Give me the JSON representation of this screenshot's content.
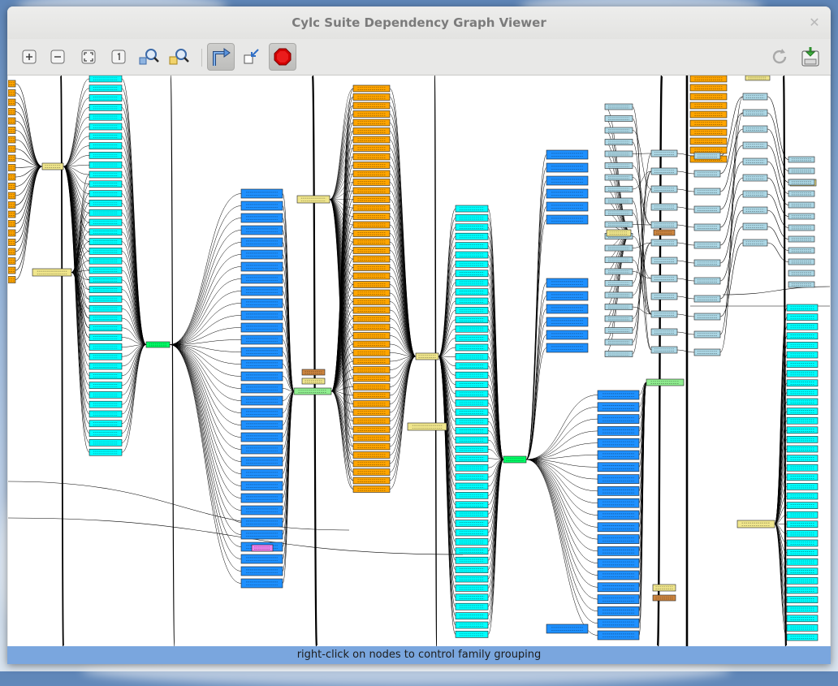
{
  "window": {
    "title": "Cylc Suite Dependency Graph Viewer"
  },
  "toolbar": {
    "buttons": [
      {
        "name": "zoom-in-button",
        "icon": "zoom-in-icon"
      },
      {
        "name": "zoom-out-button",
        "icon": "zoom-out-icon"
      },
      {
        "name": "zoom-fit-button",
        "icon": "zoom-fit-icon"
      },
      {
        "name": "zoom-normal-button",
        "icon": "zoom-100-icon"
      },
      {
        "name": "find-button",
        "icon": "find-icon"
      },
      {
        "name": "find-next-button",
        "icon": "find-next-icon"
      },
      {
        "name": "landscape-toggle-button",
        "icon": "landscape-arrow-icon"
      },
      {
        "name": "group-button",
        "icon": "group-icon"
      },
      {
        "name": "stop-button",
        "icon": "stop-icon"
      },
      {
        "name": "refresh-button",
        "icon": "refresh-icon"
      },
      {
        "name": "save-button",
        "icon": "save-icon"
      }
    ]
  },
  "colors": {
    "task_cyan": "#00ffff",
    "task_orange": "#ffa500",
    "task_blue": "#1e90ff",
    "task_khaki": "#f0e68c",
    "task_lightblue": "#add8e6",
    "task_green": "#00ff66",
    "task_lightgreen": "#90ee90",
    "task_brown": "#cd853f",
    "task_violet": "#ee82ee",
    "edge": "#000000",
    "status_bg": "#7aa6de"
  },
  "status": {
    "message": "right-click on nodes to control family grouping"
  }
}
